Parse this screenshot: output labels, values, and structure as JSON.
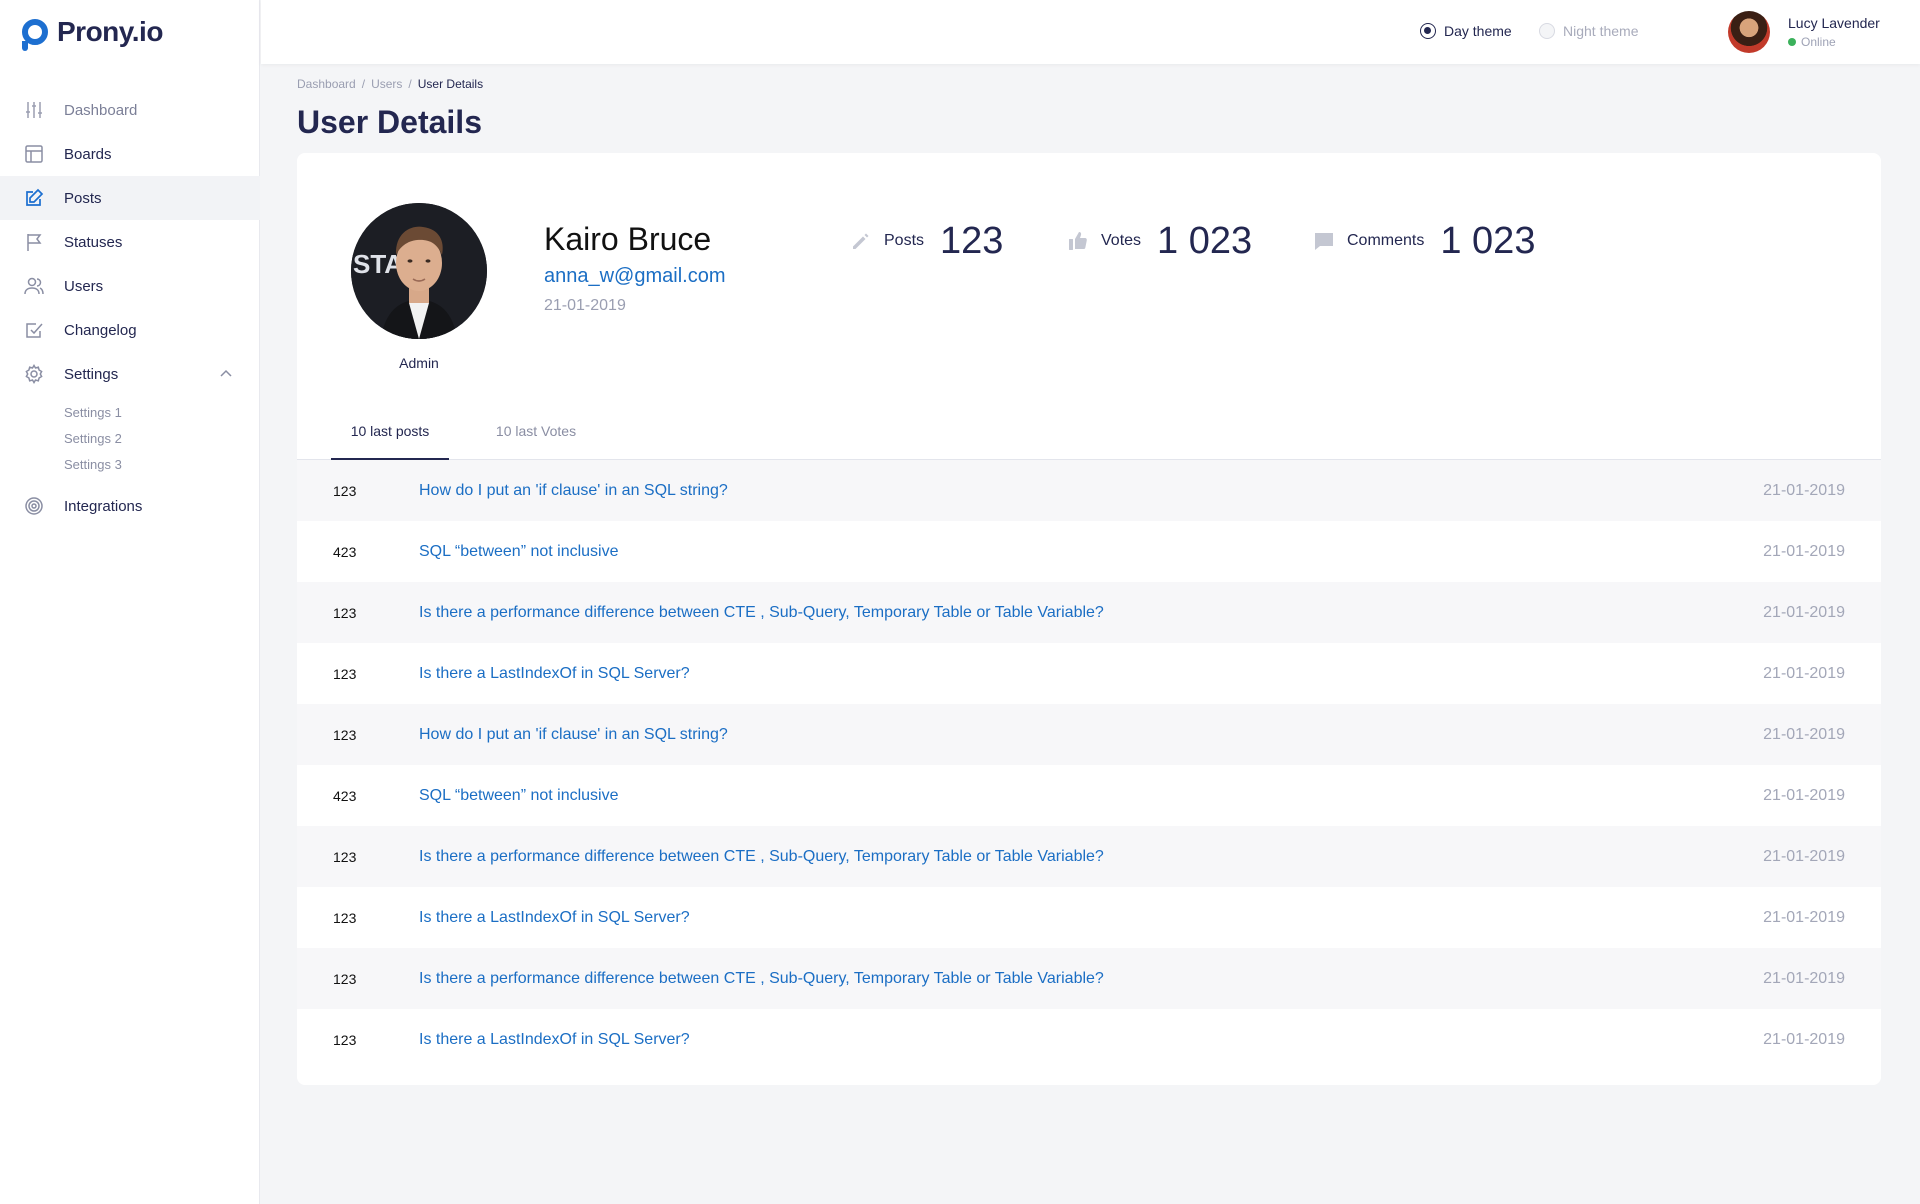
{
  "app": {
    "logo_text": "Prony.io",
    "brand_color": "#1d6fd0"
  },
  "sidebar": {
    "items": [
      {
        "label": "Dashboard",
        "icon": "sliders-icon"
      },
      {
        "label": "Boards",
        "icon": "board-icon"
      },
      {
        "label": "Posts",
        "icon": "edit-icon"
      },
      {
        "label": "Statuses",
        "icon": "flag-icon"
      },
      {
        "label": "Users",
        "icon": "users-icon"
      },
      {
        "label": "Changelog",
        "icon": "checkbox-icon"
      },
      {
        "label": "Settings",
        "icon": "gear-icon"
      },
      {
        "label": "Integrations",
        "icon": "target-icon"
      }
    ],
    "settings_sub": [
      "Settings 1",
      "Settings 2",
      "Settings 3"
    ]
  },
  "header": {
    "day_theme": "Day theme",
    "night_theme": "Night theme",
    "user_name": "Lucy Lavender",
    "user_status": "Online"
  },
  "breadcrumb": {
    "items": [
      "Dashboard",
      "Users",
      "User Details"
    ],
    "separator": "/"
  },
  "page_title": "User Details",
  "profile": {
    "name": "Kairo Bruce",
    "email": "anna_w@gmail.com",
    "date": "21-01-2019",
    "role": "Admin",
    "stats": {
      "posts_label": "Posts",
      "posts_value": "123",
      "votes_label": "Votes",
      "votes_value": "1 023",
      "comments_label": "Comments",
      "comments_value": "1 023"
    }
  },
  "tabs": {
    "active": "10 last posts",
    "inactive": "10 last Votes"
  },
  "posts": [
    {
      "count": "123",
      "title": "How do I put an 'if clause' in an SQL string?",
      "date": "21-01-2019"
    },
    {
      "count": "423",
      "title": "SQL “between” not inclusive",
      "date": "21-01-2019"
    },
    {
      "count": "123",
      "title": "Is there a performance difference between CTE , Sub-Query, Temporary Table or Table Variable?",
      "date": "21-01-2019"
    },
    {
      "count": "123",
      "title": "Is there a LastIndexOf in SQL Server?",
      "date": "21-01-2019"
    },
    {
      "count": "123",
      "title": "How do I put an 'if clause' in an SQL string?",
      "date": "21-01-2019"
    },
    {
      "count": "423",
      "title": "SQL “between” not inclusive",
      "date": "21-01-2019"
    },
    {
      "count": "123",
      "title": "Is there a performance difference between CTE , Sub-Query, Temporary Table or Table Variable?",
      "date": "21-01-2019"
    },
    {
      "count": "123",
      "title": "Is there a LastIndexOf in SQL Server?",
      "date": "21-01-2019"
    },
    {
      "count": "123",
      "title": "Is there a performance difference between CTE , Sub-Query, Temporary Table or Table Variable?",
      "date": "21-01-2019"
    },
    {
      "count": "123",
      "title": "Is there a LastIndexOf in SQL Server?",
      "date": "21-01-2019"
    }
  ]
}
